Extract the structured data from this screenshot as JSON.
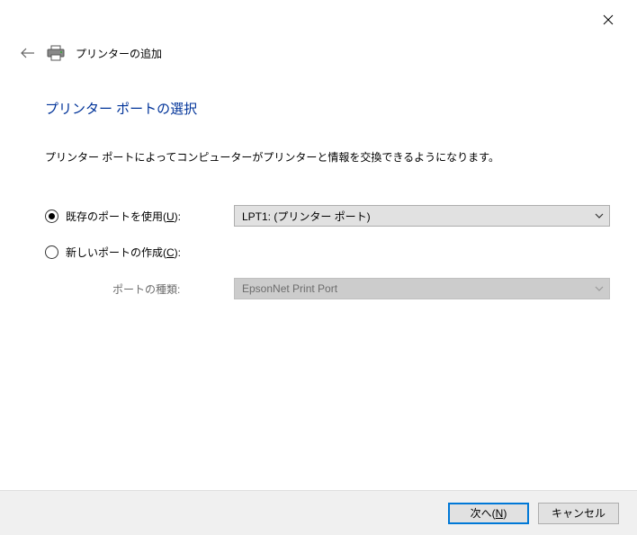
{
  "window": {
    "title": "プリンターの追加"
  },
  "page": {
    "heading": "プリンター ポートの選択",
    "description": "プリンター ポートによってコンピューターがプリンターと情報を交換できるようになります。"
  },
  "form": {
    "use_existing": {
      "label_pre": "既存のポートを使用(",
      "label_key": "U",
      "label_post": "):",
      "checked": true,
      "value": "LPT1: (プリンター ポート)"
    },
    "create_new": {
      "label_pre": "新しいポートの作成(",
      "label_key": "C",
      "label_post": "):",
      "checked": false
    },
    "port_type": {
      "label": "ポートの種類:",
      "value": "EpsonNet Print Port",
      "disabled": true
    }
  },
  "buttons": {
    "next_pre": "次へ(",
    "next_key": "N",
    "next_post": ")",
    "cancel": "キャンセル"
  }
}
